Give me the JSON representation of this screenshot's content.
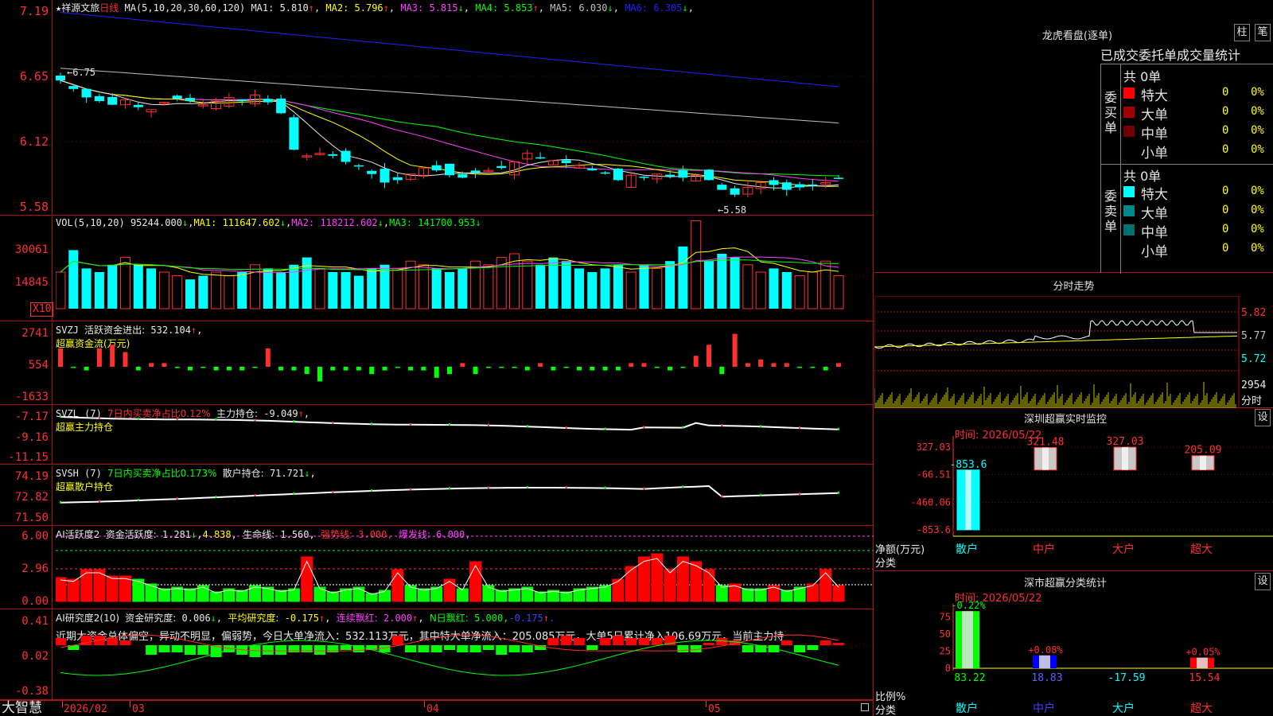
{
  "app_brand": "大智慧",
  "kline": {
    "star": "★",
    "name": "祥源文旅",
    "period": "日线",
    "ma_formula": "MA(5,10,20,30,60,120)",
    "ma": [
      {
        "label": "MA1:",
        "value": "5.810",
        "arrow": "↑",
        "color": "#e8e8e8"
      },
      {
        "label": "MA2:",
        "value": "5.796",
        "arrow": "↑",
        "color": "#ffff00"
      },
      {
        "label": "MA3:",
        "value": "5.815",
        "arrow": "↓",
        "color": "#ff40ff"
      },
      {
        "label": "MA4:",
        "value": "5.853",
        "arrow": "↑",
        "color": "#00ff00"
      },
      {
        "label": "MA5:",
        "value": "6.030",
        "arrow": "↓",
        "color": "#c0c0c0"
      },
      {
        "label": "MA6:",
        "value": "6.305",
        "arrow": "↓",
        "color": "#2020ff"
      }
    ],
    "y_labels": [
      "7.19",
      "6.65",
      "6.12",
      "5.58"
    ],
    "high_marker": "6.75",
    "low_marker": "←5.58"
  },
  "vol": {
    "formula": "VOL(5,10,20)",
    "value": "95244.000",
    "value_arrow": "↓",
    "ma1": "111647.602",
    "ma2": "118212.602",
    "ma3": "141700.953",
    "y_labels": [
      "30061",
      "14845"
    ],
    "unit": "X10"
  },
  "svzj": {
    "label": "SVZJ",
    "line1": "活跃资金进出:",
    "value": "532.104",
    "arrow": "↑",
    "line2": "超赢资金流(万元)",
    "y_labels": [
      "2741",
      "554",
      "-1633"
    ]
  },
  "svzl": {
    "label": "SVZL (7)",
    "desc": "7日内买卖净占比0.12%",
    "hold": "主力持仓:",
    "value": "-9.049",
    "arrow": "↑",
    "line2": "超赢主力持仓",
    "y_labels": [
      "-7.17",
      "-9.16",
      "-11.15"
    ]
  },
  "svsh": {
    "label": "SVSH (7)",
    "desc": "7日内买卖净占比0.173%",
    "hold": "散户持仓:",
    "value": "71.721",
    "arrow": "↓",
    "line2": "超赢散户持仓",
    "y_labels": [
      "74.19",
      "72.82",
      "71.50"
    ]
  },
  "ai_active": {
    "label": "AI活跃度2",
    "item1": "资金活跃度:",
    "v1": "1.281",
    "v1_arrow": "↓",
    "v2": "4.838",
    "item3": "生命线:",
    "v3": "1.560",
    "item4": "强势线:",
    "v4": "3.000",
    "item5": "爆发线:",
    "v5": "6.000",
    "y_labels": [
      "6.00",
      "2.96",
      "0.00"
    ]
  },
  "ai_research": {
    "label": "AI研究度2(10)",
    "item1": "资金研究度:",
    "v1": "0.006",
    "v1_arrow": "↓",
    "item2": "平均研究度:",
    "v2": "-0.175",
    "v2_arrow": "↑",
    "item3": "连续飘红:",
    "v3": "2.000",
    "v3_arrow": "↑",
    "item4": "N日飘红:",
    "v4": "5.000",
    "v5": "-0.175",
    "v5_arrow": "↑",
    "comment": "近期大资金总体偏空，异动不明显，偏弱势，今日大单净流入：532.113万元，其中特大单净流入：205.085万元，大单5日累计净入106.69万元，当前主力持",
    "y_labels": [
      "0.41",
      "0.02",
      "-0.38"
    ]
  },
  "x_axis": {
    "labels": [
      "2026/02",
      "03",
      "04",
      "05"
    ]
  },
  "dragon": {
    "title": "龙虎看盘(逐单)",
    "btn1": "柱",
    "btn2": "笔",
    "subtitle": "已成交委托单成交量统计",
    "buy_side": "委买单",
    "sell_side": "委卖单",
    "buy_total": "共 0单",
    "sell_total": "共 0单",
    "buy_rows": [
      {
        "name": "特大",
        "count": "0",
        "pct": "0%",
        "color": "#ff0000"
      },
      {
        "name": "大单",
        "count": "0",
        "pct": "0%",
        "color": "#a00000"
      },
      {
        "name": "中单",
        "count": "0",
        "pct": "0%",
        "color": "#700000"
      },
      {
        "name": "小单",
        "count": "0",
        "pct": "0%",
        "color": ""
      }
    ],
    "sell_rows": [
      {
        "name": "特大",
        "count": "0",
        "pct": "0%",
        "color": "#00ffff"
      },
      {
        "name": "大单",
        "count": "0",
        "pct": "0%",
        "color": "#008888"
      },
      {
        "name": "中单",
        "count": "0",
        "pct": "0%",
        "color": "#007070"
      },
      {
        "name": "小单",
        "count": "0",
        "pct": "0%",
        "color": ""
      }
    ]
  },
  "intraday": {
    "title": "分时走势",
    "y_labels": [
      "5.82",
      "5.77",
      "5.72"
    ],
    "vol_top": "2954",
    "vol_unit": "分时"
  },
  "sz_monitor": {
    "title": "深圳超赢实时监控",
    "btn": "设",
    "time": "时间: 2026/05/22",
    "y_labels": [
      "327.03",
      "-66.51",
      "-460.06",
      "-853.6"
    ],
    "axis_label_1": "净额(万元)",
    "axis_label_2": "分类",
    "chart_data": {
      "type": "bar",
      "categories": [
        "散户",
        "中户",
        "大户",
        "超大"
      ],
      "values": [
        -853.6,
        321.48,
        327.03,
        205.09
      ],
      "value_labels": [
        "-853.6",
        "321.48",
        "327.03",
        "205.09"
      ],
      "ylim": [
        -853.6,
        327.03
      ]
    }
  },
  "sz_class": {
    "title": "深市超赢分类统计",
    "btn": "设",
    "time": "时间: 2026/05/22",
    "y_labels": [
      "75",
      "50",
      "25",
      "0"
    ],
    "axis_label_1": "比例%",
    "axis_label_2": "分类",
    "chart_data": {
      "type": "bar",
      "categories": [
        "散户",
        "中户",
        "大户",
        "超大"
      ],
      "values": [
        83.22,
        18.83,
        -17.59,
        15.54
      ],
      "value_labels": [
        "83.22",
        "18.83",
        "-17.59",
        "15.54"
      ],
      "change_labels": [
        "-0.22%",
        "+0.08%",
        "",
        "+0.05%"
      ],
      "ylim": [
        0,
        83.22
      ]
    }
  },
  "colors": {
    "up": "#ff3030",
    "down": "#00ffff",
    "grid": "#b01010"
  }
}
